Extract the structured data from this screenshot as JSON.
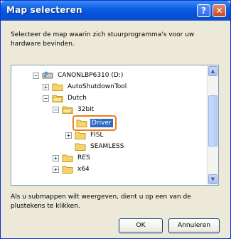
{
  "window": {
    "title": "Map selecteren"
  },
  "titlebar": {
    "help_label": "?",
    "close_label": "✕"
  },
  "description": "Selecteer de map waarin zich stuurprogramma's voor uw hardware bevinden.",
  "tree": {
    "items": [
      {
        "label": "CANONLBP6310 (D:)",
        "expander": "⊟",
        "icon": "drive-icon"
      },
      {
        "label": "AutoShutdownTool",
        "expander": "⊞",
        "icon": "folder-icon"
      },
      {
        "label": "Dutch",
        "expander": "⊟",
        "icon": "folder-open-icon"
      },
      {
        "label": "32bit",
        "expander": "⊟",
        "icon": "folder-open-icon"
      },
      {
        "label": "Driver",
        "expander": "",
        "icon": "folder-icon",
        "selected": true
      },
      {
        "label": "FISL",
        "expander": "⊞",
        "icon": "folder-icon"
      },
      {
        "label": "SEAMLESS",
        "expander": "",
        "icon": "folder-icon"
      },
      {
        "label": "RES",
        "expander": "⊞",
        "icon": "folder-icon"
      },
      {
        "label": "x64",
        "expander": "⊞",
        "icon": "folder-icon"
      }
    ]
  },
  "note": "Als u submappen wilt weergeven, dient u op een van de plustekens te klikken.",
  "buttons": {
    "ok": "OK",
    "cancel": "Annuleren"
  },
  "colors": {
    "title_bar": "#0a5fe6",
    "selection": "#316ac5",
    "highlight_border": "#f07d1a"
  }
}
